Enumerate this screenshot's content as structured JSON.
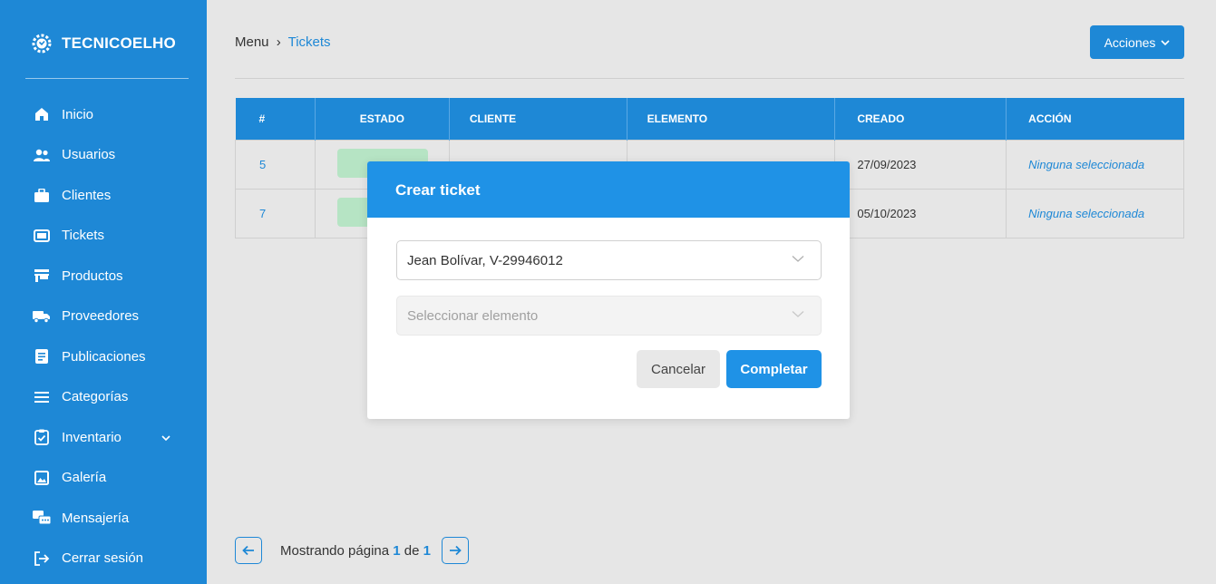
{
  "brand": {
    "name": "TECNICOELHO"
  },
  "sidebar": {
    "items": [
      {
        "label": "Inicio",
        "icon": "home-icon"
      },
      {
        "label": "Usuarios",
        "icon": "users-icon"
      },
      {
        "label": "Clientes",
        "icon": "briefcase-icon"
      },
      {
        "label": "Tickets",
        "icon": "ticket-icon"
      },
      {
        "label": "Productos",
        "icon": "store-icon"
      },
      {
        "label": "Proveedores",
        "icon": "truck-icon"
      },
      {
        "label": "Publicaciones",
        "icon": "document-icon"
      },
      {
        "label": "Categorías",
        "icon": "list-icon"
      },
      {
        "label": "Inventario",
        "icon": "clipboard-check-icon"
      },
      {
        "label": "Galería",
        "icon": "image-icon"
      },
      {
        "label": "Mensajería",
        "icon": "message-icon"
      },
      {
        "label": "Cerrar sesión",
        "icon": "logout-icon"
      }
    ]
  },
  "breadcrumb": {
    "root": "Menu",
    "separator": "›",
    "current": "Tickets"
  },
  "header": {
    "actions_label": "Acciones"
  },
  "table": {
    "columns": [
      "#",
      "ESTADO",
      "CLIENTE",
      "ELEMENTO",
      "CREADO",
      "ACCIÓN"
    ],
    "rows": [
      {
        "num": "5",
        "estado": "",
        "cliente": "",
        "elemento": "",
        "creado": "27/09/2023",
        "accion": "Ninguna seleccionada"
      },
      {
        "num": "7",
        "estado": "",
        "cliente": "",
        "elemento": "",
        "creado": "05/10/2023",
        "accion": "Ninguna seleccionada"
      }
    ]
  },
  "pagination": {
    "prefix": "Mostrando página",
    "current": "1",
    "of": "de",
    "total": "1"
  },
  "modal": {
    "title": "Crear ticket",
    "client_value": "Jean Bolívar, V-29946012",
    "element_placeholder": "Seleccionar elemento",
    "cancel_label": "Cancelar",
    "complete_label": "Completar"
  },
  "colors": {
    "primary": "#1e88d6",
    "modal_header": "#1f92e6",
    "status_bg": "#b6e4c4",
    "background": "#e6e6e6"
  }
}
